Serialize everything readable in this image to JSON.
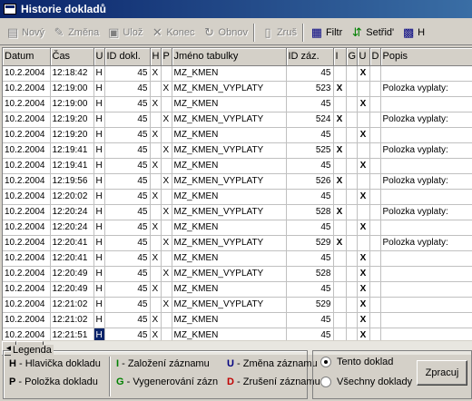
{
  "window": {
    "title": "Historie dokladů"
  },
  "toolbar": {
    "novy": "Nový",
    "zmena": "Změna",
    "uloz": "Ulož",
    "konec": "Konec",
    "obnov": "Obnov",
    "zrus": "Zruš",
    "filtr": "Filtr",
    "setrid": "Setřid'",
    "last": "H"
  },
  "columns": [
    "Datum",
    "Čas",
    "U",
    "ID dokl.",
    "H",
    "P",
    "Jméno tabulky",
    "ID záz.",
    "I",
    "G",
    "U",
    "D",
    "Popis"
  ],
  "rows": [
    [
      "10.2.2004",
      "12:18:42",
      "H",
      "45",
      "X",
      "",
      "MZ_KMEN",
      "45",
      "",
      "",
      "X",
      "",
      ""
    ],
    [
      "10.2.2004",
      "12:19:00",
      "H",
      "45",
      "",
      "X",
      "MZ_KMEN_VYPLATY",
      "523",
      "X",
      "",
      "",
      "",
      "Polozka vyplaty:"
    ],
    [
      "10.2.2004",
      "12:19:00",
      "H",
      "45",
      "X",
      "",
      "MZ_KMEN",
      "45",
      "",
      "",
      "X",
      "",
      ""
    ],
    [
      "10.2.2004",
      "12:19:20",
      "H",
      "45",
      "",
      "X",
      "MZ_KMEN_VYPLATY",
      "524",
      "X",
      "",
      "",
      "",
      "Polozka vyplaty:"
    ],
    [
      "10.2.2004",
      "12:19:20",
      "H",
      "45",
      "X",
      "",
      "MZ_KMEN",
      "45",
      "",
      "",
      "X",
      "",
      ""
    ],
    [
      "10.2.2004",
      "12:19:41",
      "H",
      "45",
      "",
      "X",
      "MZ_KMEN_VYPLATY",
      "525",
      "X",
      "",
      "",
      "",
      "Polozka vyplaty:"
    ],
    [
      "10.2.2004",
      "12:19:41",
      "H",
      "45",
      "X",
      "",
      "MZ_KMEN",
      "45",
      "",
      "",
      "X",
      "",
      ""
    ],
    [
      "10.2.2004",
      "12:19:56",
      "H",
      "45",
      "",
      "X",
      "MZ_KMEN_VYPLATY",
      "526",
      "X",
      "",
      "",
      "",
      "Polozka vyplaty:"
    ],
    [
      "10.2.2004",
      "12:20:02",
      "H",
      "45",
      "X",
      "",
      "MZ_KMEN",
      "45",
      "",
      "",
      "X",
      "",
      ""
    ],
    [
      "10.2.2004",
      "12:20:24",
      "H",
      "45",
      "",
      "X",
      "MZ_KMEN_VYPLATY",
      "528",
      "X",
      "",
      "",
      "",
      "Polozka vyplaty:"
    ],
    [
      "10.2.2004",
      "12:20:24",
      "H",
      "45",
      "X",
      "",
      "MZ_KMEN",
      "45",
      "",
      "",
      "X",
      "",
      ""
    ],
    [
      "10.2.2004",
      "12:20:41",
      "H",
      "45",
      "",
      "X",
      "MZ_KMEN_VYPLATY",
      "529",
      "X",
      "",
      "",
      "",
      "Polozka vyplaty:"
    ],
    [
      "10.2.2004",
      "12:20:41",
      "H",
      "45",
      "X",
      "",
      "MZ_KMEN",
      "45",
      "",
      "",
      "X",
      "",
      ""
    ],
    [
      "10.2.2004",
      "12:20:49",
      "H",
      "45",
      "",
      "X",
      "MZ_KMEN_VYPLATY",
      "528",
      "",
      "",
      "X",
      "",
      ""
    ],
    [
      "10.2.2004",
      "12:20:49",
      "H",
      "45",
      "X",
      "",
      "MZ_KMEN",
      "45",
      "",
      "",
      "X",
      "",
      ""
    ],
    [
      "10.2.2004",
      "12:21:02",
      "H",
      "45",
      "",
      "X",
      "MZ_KMEN_VYPLATY",
      "529",
      "",
      "",
      "X",
      "",
      ""
    ],
    [
      "10.2.2004",
      "12:21:02",
      "H",
      "45",
      "X",
      "",
      "MZ_KMEN",
      "45",
      "",
      "",
      "X",
      "",
      ""
    ],
    [
      "10.2.2004",
      "12:21:51",
      "H",
      "45",
      "X",
      "",
      "MZ_KMEN",
      "45",
      "",
      "",
      "X",
      "",
      ""
    ]
  ],
  "legend": {
    "title": "Legenda",
    "items": [
      {
        "key": "H",
        "text": " - Hlavička dokladu",
        "color": "#000000"
      },
      {
        "key": "P",
        "text": " - Položka dokladu",
        "color": "#000000"
      },
      {
        "key": "I",
        "text": " - Založení záznamu",
        "color": "#008000"
      },
      {
        "key": "G",
        "text": " - Vygenerování zázn",
        "color": "#008000"
      },
      {
        "key": "U",
        "text": " - Změna záznamu",
        "color": "#000080"
      },
      {
        "key": "D",
        "text": " - Zrušení záznamu",
        "color": "#c00000"
      }
    ]
  },
  "options": {
    "radio1": "Tento doklad",
    "radio1_selected": true,
    "radio2": "Všechny doklady",
    "radio2_selected": false,
    "process": "Zpracuj"
  },
  "colors": {
    "selection": "#0a246a",
    "titlebar": "#0a246a"
  }
}
